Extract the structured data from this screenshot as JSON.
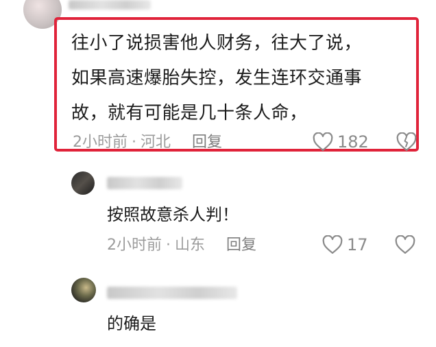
{
  "main_comment": {
    "text_lines": [
      "往小了说损害他人财务，往大了说，",
      "如果高速爆胎失控，发生连环交通事",
      "故，就有可能是几十条人命，"
    ],
    "time": "2小时前",
    "location": "河北",
    "reply_label": "回复",
    "like_count": "182"
  },
  "replies": [
    {
      "text": "按照故意杀人判！",
      "time": "2小时前",
      "location": "山东",
      "reply_label": "回复",
      "like_count": "17"
    },
    {
      "text": "的确是"
    }
  ],
  "colors": {
    "highlight_border": "#e0233a",
    "meta_text": "#9b9b9b"
  }
}
